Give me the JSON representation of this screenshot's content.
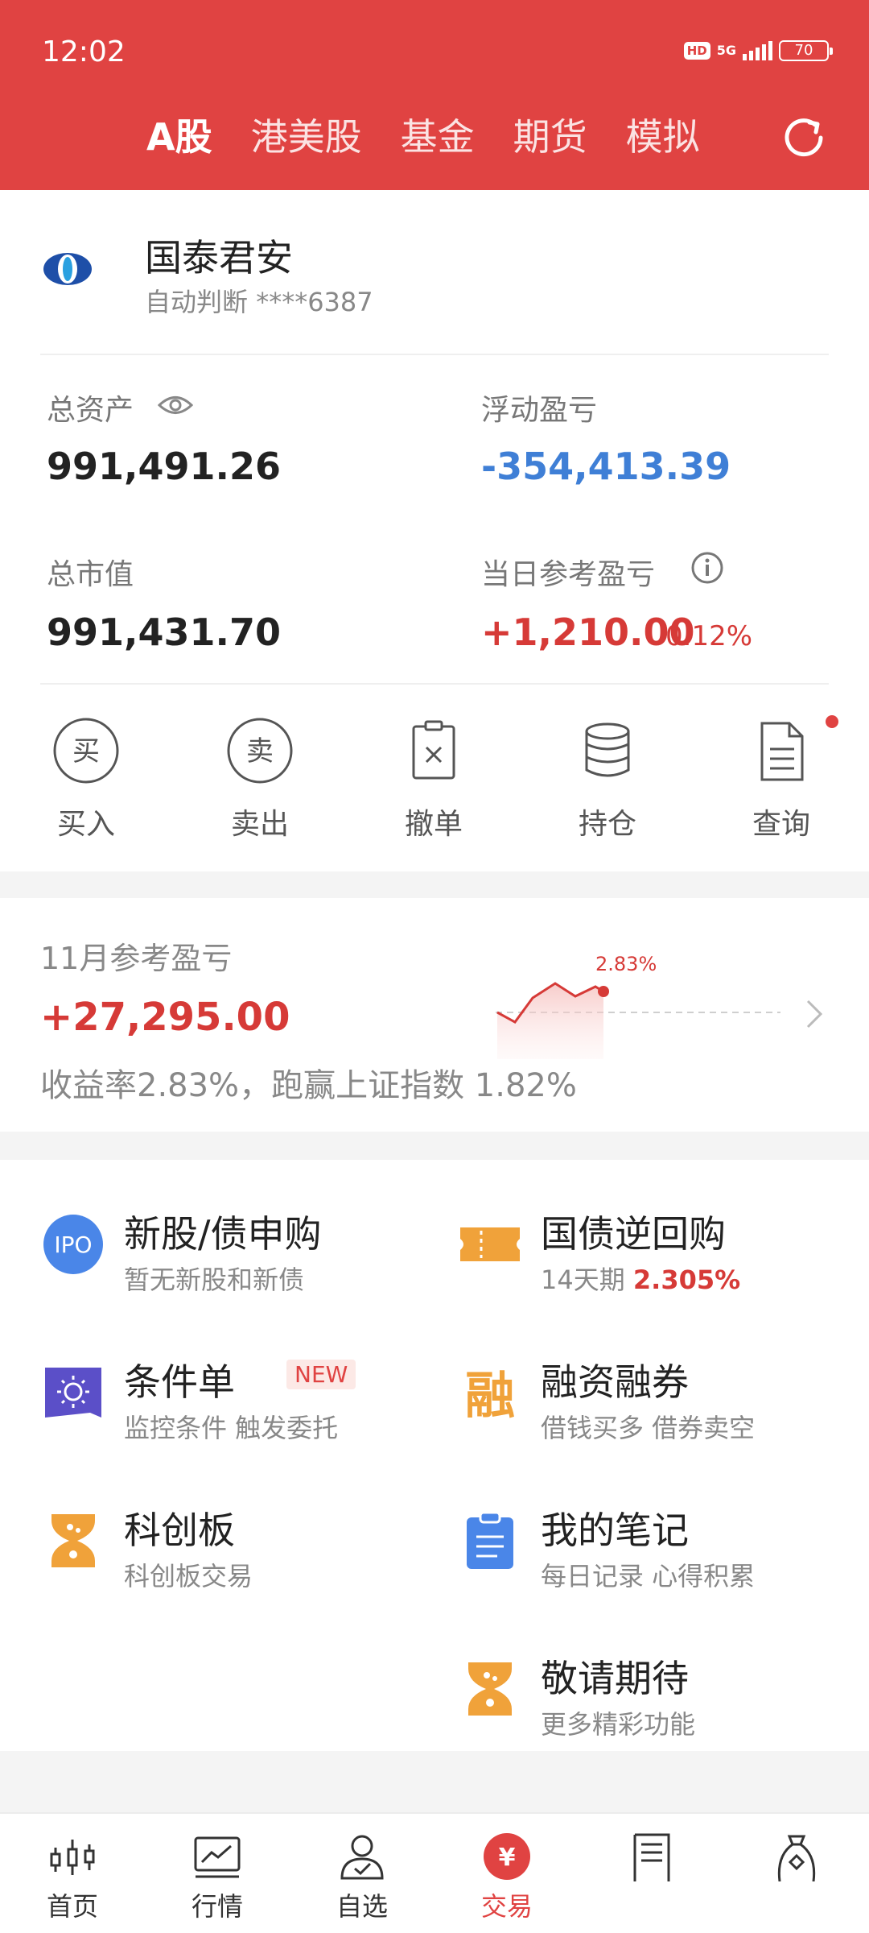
{
  "status_bar": {
    "time": "12:02",
    "hd": "HD",
    "network": "5G",
    "battery": "70"
  },
  "market_tabs": [
    {
      "label": "A股",
      "active": true
    },
    {
      "label": "港美股",
      "active": false
    },
    {
      "label": "基金",
      "active": false
    },
    {
      "label": "期货",
      "active": false
    },
    {
      "label": "模拟",
      "active": false
    }
  ],
  "account": {
    "broker_name": "国泰君安",
    "mode": "自动判断",
    "account_no": "****6387",
    "total_assets_label": "总资产",
    "total_assets": "991,491.26",
    "floating_pnl_label": "浮动盈亏",
    "floating_pnl": "-354,413.39",
    "market_value_label": "总市值",
    "market_value": "991,431.70",
    "daily_pnl_label": "当日参考盈亏",
    "daily_pnl": "+1,210.00",
    "daily_pnl_pct": "0.12%"
  },
  "actions": [
    {
      "label": "买入",
      "icon_text": "买"
    },
    {
      "label": "卖出",
      "icon_text": "卖"
    },
    {
      "label": "撤单"
    },
    {
      "label": "持仓"
    },
    {
      "label": "查询"
    }
  ],
  "monthly": {
    "title": "11月参考盈亏",
    "value": "+27,295.00",
    "description": "收益率2.83%，跑赢上证指数 1.82%",
    "chart_label": "2.83%"
  },
  "features": [
    {
      "title": "新股/债申购",
      "subtitle": "暂无新股和新债",
      "icon": "ipo-icon",
      "icon_text": "IPO"
    },
    {
      "title": "国债逆回购",
      "subtitle": "14天期",
      "rate": "2.305%",
      "icon": "ticket-icon"
    },
    {
      "title": "条件单",
      "badge": "NEW",
      "subtitle": "监控条件 触发委托",
      "icon": "condition-order-icon"
    },
    {
      "title": "融资融券",
      "subtitle": "借钱买多 借券卖空",
      "icon": "margin-icon",
      "icon_text": "融"
    },
    {
      "title": "科创板",
      "subtitle": "科创板交易",
      "icon": "hourglass-icon"
    },
    {
      "title": "我的笔记",
      "subtitle": "每日记录 心得积累",
      "icon": "clipboard-icon"
    },
    {
      "title": "敬请期待",
      "subtitle": "更多精彩功能",
      "icon": "hourglass-icon"
    }
  ],
  "bottom_nav": [
    {
      "label": "首页",
      "icon": "candlestick-icon"
    },
    {
      "label": "行情",
      "icon": "chart-icon"
    },
    {
      "label": "自选",
      "icon": "person-check-icon"
    },
    {
      "label": "交易",
      "icon": "yuan-icon",
      "icon_text": "¥",
      "active": true
    },
    {
      "label": "",
      "icon": "document-icon"
    },
    {
      "label": "",
      "icon": "money-bag-icon"
    }
  ],
  "colors": {
    "header": "#e04342",
    "up": "#d63a37",
    "down": "#3f7fd6",
    "accent_orange": "#f0a23a",
    "accent_purple": "#5b4fc8",
    "accent_blue": "#4a86e8"
  }
}
